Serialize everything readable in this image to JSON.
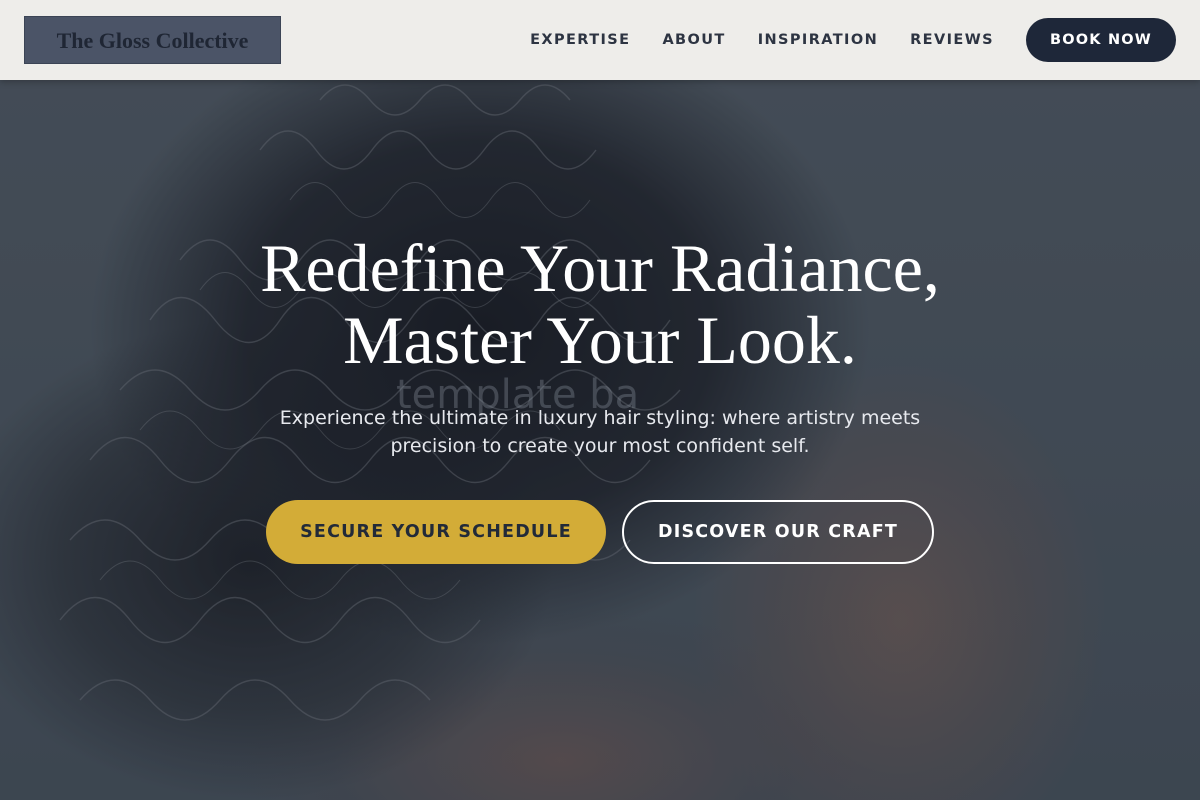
{
  "header": {
    "logo_text": "The Gloss Collective",
    "nav": [
      {
        "label": "EXPERTISE"
      },
      {
        "label": "ABOUT"
      },
      {
        "label": "INSPIRATION"
      },
      {
        "label": "REVIEWS"
      }
    ],
    "cta_label": "BOOK NOW"
  },
  "hero": {
    "title_line1": "Redefine Your Radiance,",
    "title_line2": "Master Your Look.",
    "watermark": "template ba",
    "subtitle_line1": "Experience the ultimate in luxury hair styling: where artistry meets",
    "subtitle_line2": "precision to create your most confident self.",
    "primary_cta": "SECURE YOUR SCHEDULE",
    "secondary_cta": "DISCOVER OUR CRAFT"
  },
  "colors": {
    "header_bg": "#eeedea",
    "logo_bg": "#4b5467",
    "navy": "#1e2739",
    "gold": "#d3ac37",
    "white": "#ffffff"
  }
}
